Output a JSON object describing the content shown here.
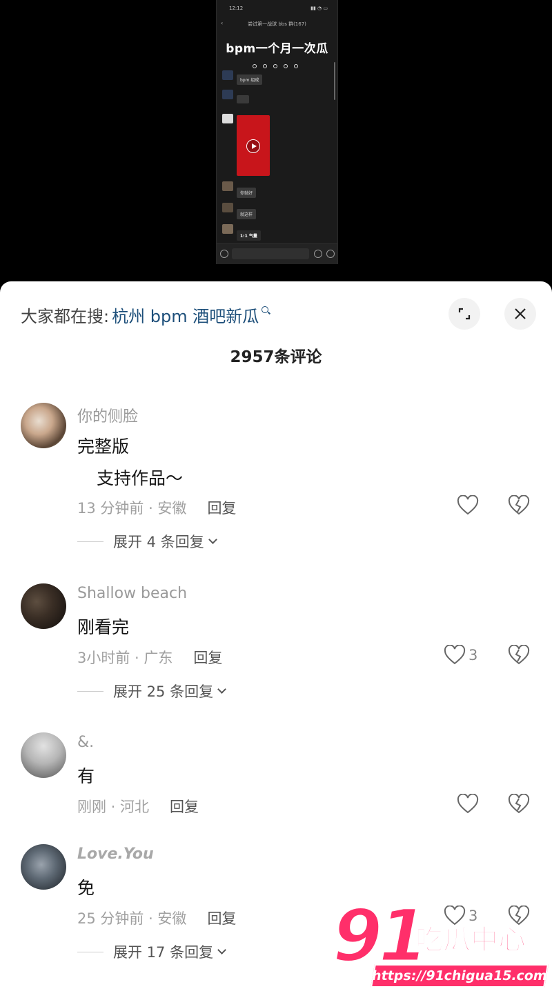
{
  "video": {
    "chat_title": "尝试第一战球 bbs 群(167)",
    "overlay_title": "bpm一个月一次瓜",
    "status_time": "12:12",
    "bubble1": "bpm 组成",
    "bubble2": "你就好",
    "bubble3": "就这样",
    "bubble4": "1:1 气量"
  },
  "search": {
    "prefix": "大家都在搜:",
    "term": "杭州 bpm 酒吧新瓜"
  },
  "comments_count": "2957条评论",
  "comments": [
    {
      "username": "你的侧脸",
      "text_line1": "完整版",
      "text_line2": "支持作品～",
      "meta": "13 分钟前 · 安徽",
      "reply": "回复",
      "likes": "",
      "expand": "展开 4 条回复"
    },
    {
      "username": "Shallow beach",
      "text_line1": "刚看完",
      "meta": "3小时前 · 广东",
      "reply": "回复",
      "likes": "3",
      "expand": "展开 25 条回复"
    },
    {
      "username": "&.",
      "text_line1": "有",
      "meta": "刚刚 · 河北",
      "reply": "回复",
      "likes": ""
    },
    {
      "username": "Love.You",
      "text_line1": "免",
      "meta": "25 分钟前 · 安徽",
      "reply": "回复",
      "likes": "3",
      "expand": "展开 17 条回复"
    }
  ],
  "watermark": {
    "number": "91",
    "cn": "吃瓜中心",
    "url": "https://91chigua15.com"
  },
  "colors": {
    "search_term": "#1d4f7a",
    "watermark": "#ff2f6a"
  }
}
